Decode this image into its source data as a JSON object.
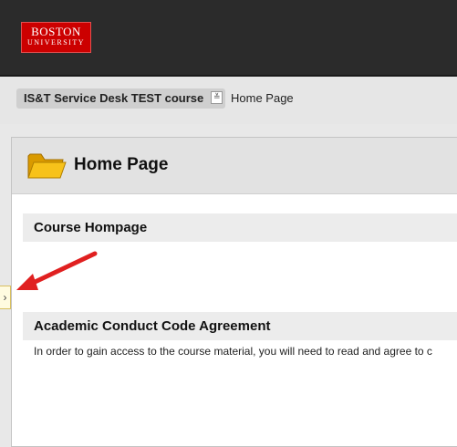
{
  "header": {
    "logo_line1": "BOSTON",
    "logo_line2": "UNIVERSITY"
  },
  "breadcrumb": {
    "course": "IS&T Service Desk TEST course",
    "dropdown_glyph": "≚",
    "current": "Home Page"
  },
  "page": {
    "title": "Home Page",
    "icon": "folder-icon"
  },
  "sections": [
    {
      "title": "Course Hompage",
      "body": ""
    },
    {
      "title": "Academic Conduct Code Agreement",
      "body": "In order to gain access to the course material, you will need to read and agree to c"
    }
  ],
  "menu_toggle": {
    "glyph": "›"
  },
  "colors": {
    "topbar": "#2b2b2b",
    "brand_red": "#cc0000",
    "annotation_arrow": "#e02020",
    "folder": "#f4b400"
  }
}
